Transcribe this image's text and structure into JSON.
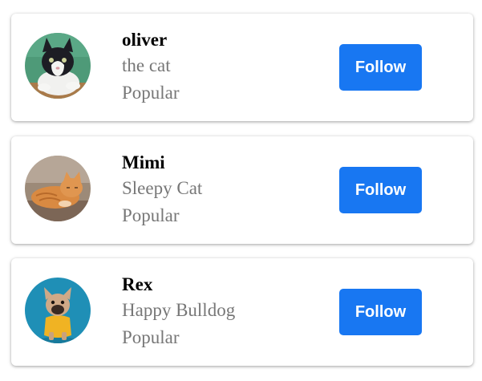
{
  "accent_color": "#1877f2",
  "cards": [
    {
      "name": "oliver",
      "subtitle": "the cat",
      "tag": "Popular",
      "button_label": "Follow",
      "avatar_icon": "cat-avatar-icon"
    },
    {
      "name": "Mimi",
      "subtitle": "Sleepy Cat",
      "tag": "Popular",
      "button_label": "Follow",
      "avatar_icon": "cat-avatar-icon"
    },
    {
      "name": "Rex",
      "subtitle": "Happy Bulldog",
      "tag": "Popular",
      "button_label": "Follow",
      "avatar_icon": "dog-avatar-icon"
    }
  ]
}
